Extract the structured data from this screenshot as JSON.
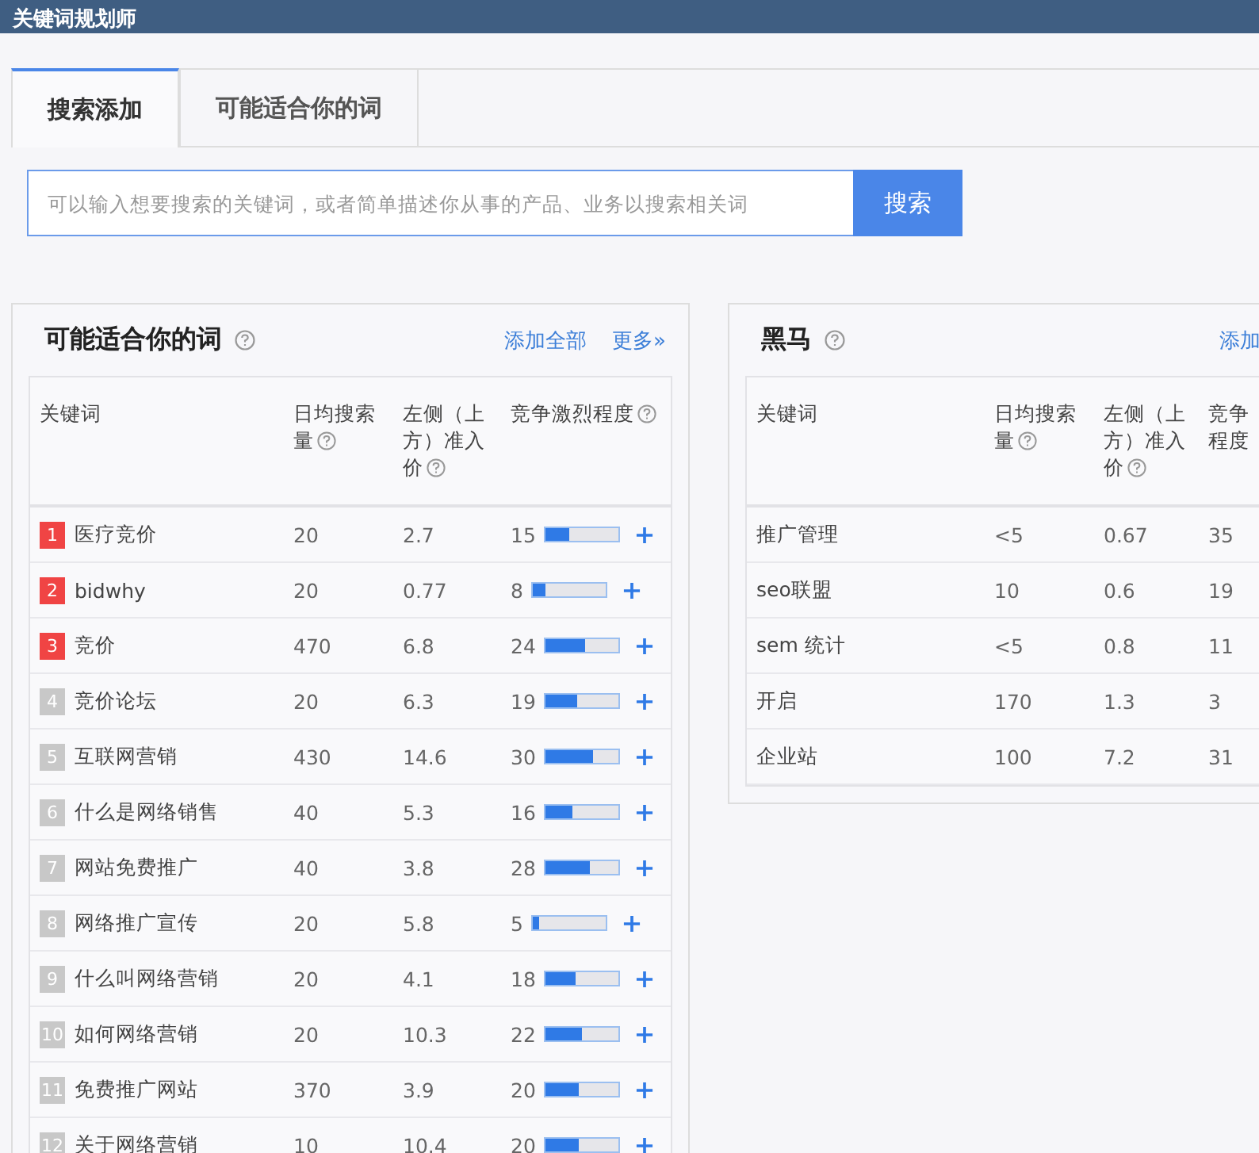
{
  "title_bar": {
    "title": "关键词规划师"
  },
  "tabs": [
    {
      "label": "搜索添加",
      "selected": true
    },
    {
      "label": "可能适合你的词",
      "selected": false
    }
  ],
  "search": {
    "placeholder": "可以输入想要搜索的关键词，或者简单描述你从事的产品、业务以搜索相关词",
    "button": "搜索"
  },
  "panels": [
    {
      "title": "可能适合你的词",
      "help": true,
      "links": [
        "添加全部",
        "更多»"
      ],
      "columns": [
        {
          "label": "关键词",
          "help": false
        },
        {
          "label": "日均搜索量",
          "help": true
        },
        {
          "label": "左侧（上方）准入价",
          "help": true
        },
        {
          "label": "竞争激烈程度",
          "help": true
        }
      ],
      "rows": [
        {
          "rank": "1",
          "color": "#f04444",
          "keyword": "医疗竞价",
          "daily": "20",
          "price": "2.7",
          "competition": "15",
          "level": 0.33
        },
        {
          "rank": "2",
          "color": "#f04444",
          "keyword": "bidwhy",
          "daily": "20",
          "price": "0.77",
          "competition": "8",
          "level": 0.18
        },
        {
          "rank": "3",
          "color": "#f04444",
          "keyword": "竞价",
          "daily": "470",
          "price": "6.8",
          "competition": "24",
          "level": 0.54
        },
        {
          "rank": "4",
          "color": "#c8c8c8",
          "keyword": "竞价论坛",
          "daily": "20",
          "price": "6.3",
          "competition": "19",
          "level": 0.43
        },
        {
          "rank": "5",
          "color": "#c8c8c8",
          "keyword": "互联网营销",
          "daily": "430",
          "price": "14.6",
          "competition": "30",
          "level": 0.66
        },
        {
          "rank": "6",
          "color": "#c8c8c8",
          "keyword": "什么是网络销售",
          "daily": "40",
          "price": "5.3",
          "competition": "16",
          "level": 0.37
        },
        {
          "rank": "7",
          "color": "#c8c8c8",
          "keyword": "网站免费推广",
          "daily": "40",
          "price": "3.8",
          "competition": "28",
          "level": 0.61
        },
        {
          "rank": "8",
          "color": "#c8c8c8",
          "keyword": "网络推广宣传",
          "daily": "20",
          "price": "5.8",
          "competition": "5",
          "level": 0.08
        },
        {
          "rank": "9",
          "color": "#c8c8c8",
          "keyword": "什么叫网络营销",
          "daily": "20",
          "price": "4.1",
          "competition": "18",
          "level": 0.41
        },
        {
          "rank": "10",
          "color": "#c8c8c8",
          "keyword": "如何网络营销",
          "daily": "20",
          "price": "10.3",
          "competition": "22",
          "level": 0.5
        },
        {
          "rank": "11",
          "color": "#c8c8c8",
          "keyword": "免费推广网站",
          "daily": "370",
          "price": "3.9",
          "competition": "20",
          "level": 0.45
        },
        {
          "rank": "12",
          "color": "#c8c8c8",
          "keyword": "关于网络营销",
          "daily": "10",
          "price": "10.4",
          "competition": "20",
          "level": 0.45
        }
      ]
    },
    {
      "title": "黑马",
      "help": true,
      "links": [
        "添加"
      ],
      "columns": [
        {
          "label": "关键词",
          "help": false
        },
        {
          "label": "日均搜索量",
          "help": true
        },
        {
          "label": "左侧（上方）准入价",
          "help": true
        },
        {
          "label": "竞争程度",
          "help": false
        }
      ],
      "rows": [
        {
          "keyword": "推广管理",
          "daily": "<5",
          "price": "0.67",
          "competition": "35"
        },
        {
          "keyword": "seo联盟",
          "daily": "10",
          "price": "0.6",
          "competition": "19"
        },
        {
          "keyword": "sem 统计",
          "daily": "<5",
          "price": "0.8",
          "competition": "11"
        },
        {
          "keyword": "开启",
          "daily": "170",
          "price": "1.3",
          "competition": "3"
        },
        {
          "keyword": "企业站",
          "daily": "100",
          "price": "7.2",
          "competition": "31"
        }
      ]
    }
  ]
}
